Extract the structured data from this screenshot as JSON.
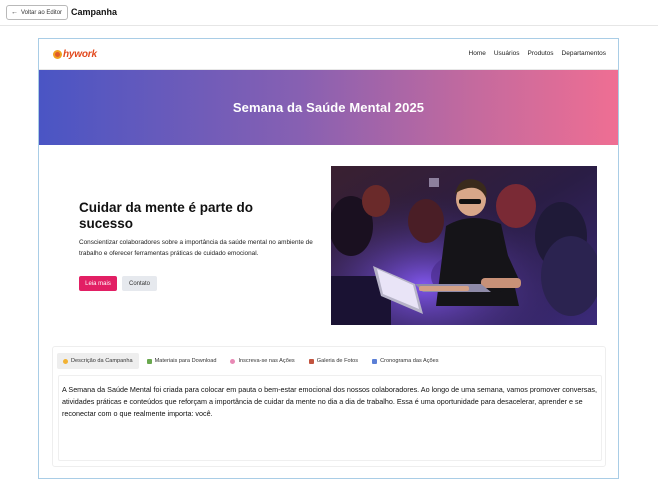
{
  "editor": {
    "back_label": "Voltar ao Editor",
    "title": "Campanha"
  },
  "site": {
    "brand": "hywork",
    "nav": [
      "Home",
      "Usuários",
      "Produtos",
      "Departamentos"
    ]
  },
  "hero": {
    "title": "Semana da Saúde Mental 2025"
  },
  "intro": {
    "heading": "Cuidar da mente é parte do sucesso",
    "text": "Conscientizar colaboradores sobre a importância da saúde mental no ambiente de trabalho e oferecer ferramentas práticas de cuidado emocional.",
    "primary_button": "Leia mais",
    "secondary_button": "Contato"
  },
  "tabs": [
    {
      "label": "Descrição da Campanha",
      "icon": "lightbulb-icon",
      "icon_color": "#f2b233"
    },
    {
      "label": "Materiais para Download",
      "icon": "books-icon",
      "icon_color": "#6aa84f"
    },
    {
      "label": "Inscreva-se nas Ações",
      "icon": "sparkle-icon",
      "icon_color": "#e889b5"
    },
    {
      "label": "Galeria de Fotos",
      "icon": "photo-icon",
      "icon_color": "#c2543f"
    },
    {
      "label": "Cronograma das Ações",
      "icon": "calendar-icon",
      "icon_color": "#5b7fd6"
    }
  ],
  "active_tab": 0,
  "description": "A Semana da Saúde Mental foi criada para colocar em pauta o bem-estar emocional dos nossos colaboradores. Ao longo de uma semana, vamos promover conversas, atividades práticas e conteúdos que reforçam a importância de cuidar da mente no dia a dia de trabalho. Essa é uma oportunidade para desacelerar, aprender e se reconectar com o que realmente importa: você.",
  "colors": {
    "accent": "#e21f64",
    "gradient_start": "#4a55c4",
    "gradient_end": "#ef6e93",
    "brand": "#e24a1f"
  }
}
